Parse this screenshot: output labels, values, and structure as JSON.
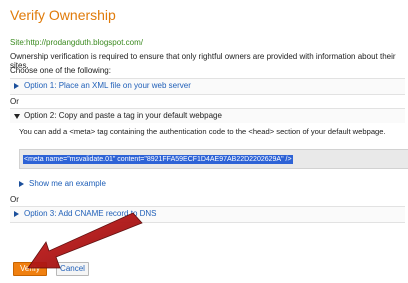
{
  "page": {
    "title": "Verify Ownership",
    "site": "Site:http://prodangduth.blogspot.com/",
    "intro": "Ownership verification is required to ensure that only rightful owners are provided with information about their sites.",
    "choose": "Choose one of the following:"
  },
  "options": [
    {
      "label": "Option 1: Place an XML file on your web server",
      "expanded": false
    },
    {
      "label": "Option 2: Copy and paste a tag in your default webpage",
      "expanded": true
    },
    {
      "label": "Option 3: Add CNAME record to DNS",
      "expanded": false
    }
  ],
  "or_label": "Or",
  "option2": {
    "description": "You can add a <meta> tag containing the authentication code to the <head> section of your default webpage.",
    "meta_tag": "<meta name=\"msvalidate.01\" content=\"8921FFA59ECF1D4AE97AB22D2202629A\" />",
    "example_link": "Show me an example"
  },
  "buttons": {
    "verify": "Verify",
    "cancel": "Cancel"
  },
  "colors": {
    "title": "#e07b0a",
    "link": "#1f5fb8",
    "site": "#3a8a1f",
    "verify_button": "#f08010",
    "selection": "#2e63d6",
    "arrow": "#b01212"
  }
}
